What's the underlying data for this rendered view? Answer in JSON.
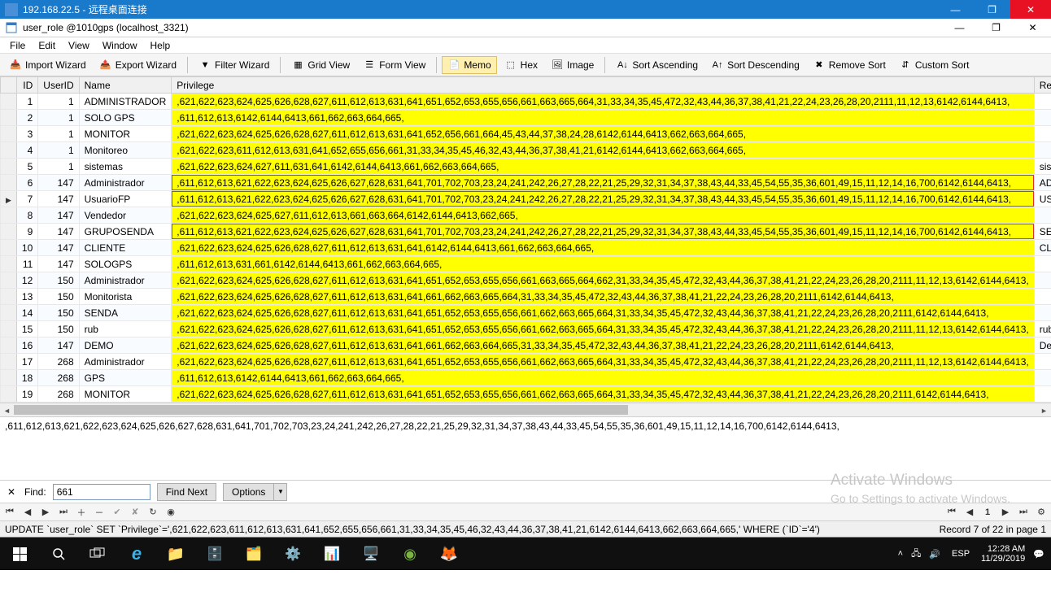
{
  "rdp": {
    "title": "192.168.22.5 - 远程桌面连接"
  },
  "app": {
    "title": "user_role @1010gps (localhost_3321)"
  },
  "menu": {
    "file": "File",
    "edit": "Edit",
    "view": "View",
    "window": "Window",
    "help": "Help"
  },
  "toolbar": {
    "import": "Import Wizard",
    "export": "Export Wizard",
    "filter": "Filter Wizard",
    "grid": "Grid View",
    "form": "Form View",
    "memo": "Memo",
    "hex": "Hex",
    "image": "Image",
    "sort_asc": "Sort Ascending",
    "sort_desc": "Sort Descending",
    "remove_sort": "Remove Sort",
    "custom_sort": "Custom Sort"
  },
  "columns": {
    "id": "ID",
    "userid": "UserID",
    "name": "Name",
    "privilege": "Privilege",
    "ren": "Ren"
  },
  "rows": [
    {
      "id": 1,
      "uid": 1,
      "name": "ADMINISTRADOR",
      "priv": ",621,622,623,624,625,626,628,627,611,612,613,631,641,651,652,653,655,656,661,663,665,664,31,33,34,35,45,472,32,43,44,36,37,38,41,21,22,24,23,26,28,20,2111,11,12,13,6142,6144,6413,",
      "ren": "",
      "hl": "yellow"
    },
    {
      "id": 2,
      "uid": 1,
      "name": "SOLO GPS",
      "priv": ",611,612,613,6142,6144,6413,661,662,663,664,665,",
      "ren": "",
      "hl": "yellow"
    },
    {
      "id": 3,
      "uid": 1,
      "name": "MONITOR",
      "priv": ",621,622,623,624,625,626,628,627,611,612,613,631,641,652,656,661,664,45,43,44,37,38,24,28,6142,6144,6413,662,663,664,665,",
      "ren": "",
      "hl": "yellow"
    },
    {
      "id": 4,
      "uid": 1,
      "name": "Monitoreo",
      "priv": ",621,622,623,611,612,613,631,641,652,655,656,661,31,33,34,35,45,46,32,43,44,36,37,38,41,21,6142,6144,6413,662,663,664,665,",
      "ren": "",
      "hl": "yellow"
    },
    {
      "id": 5,
      "uid": 1,
      "name": "sistemas",
      "priv": ",621,622,623,624,627,611,631,641,6142,6144,6413,661,662,663,664,665,",
      "ren": "siste",
      "hl": "yellow"
    },
    {
      "id": 6,
      "uid": 147,
      "name": "Administrador",
      "priv": ",611,612,613,621,622,623,624,625,626,627,628,631,641,701,702,703,23,24,241,242,26,27,28,22,21,25,29,32,31,34,37,38,43,44,33,45,54,55,35,36,601,49,15,11,12,14,16,700,6142,6144,6413,",
      "ren": "ADM",
      "hl": "red"
    },
    {
      "id": 7,
      "uid": 147,
      "name": "UsuarioFP",
      "priv": ",611,612,613,621,622,623,624,625,626,627,628,631,641,701,702,703,23,24,241,242,26,27,28,22,21,25,29,32,31,34,37,38,43,44,33,45,54,55,35,36,601,49,15,11,12,14,16,700,6142,6144,6413,",
      "ren": "USE",
      "hl": "red",
      "current": true
    },
    {
      "id": 8,
      "uid": 147,
      "name": "Vendedor",
      "priv": ",621,622,623,624,625,627,611,612,613,661,663,664,6142,6144,6413,662,665,",
      "ren": "",
      "hl": "yellow"
    },
    {
      "id": 9,
      "uid": 147,
      "name": "GRUPOSENDA",
      "priv": ",611,612,613,621,622,623,624,625,626,627,628,631,641,701,702,703,23,24,241,242,26,27,28,22,21,25,29,32,31,34,37,38,43,44,33,45,54,55,35,36,601,49,15,11,12,14,16,700,6142,6144,6413,",
      "ren": "SEN",
      "hl": "red"
    },
    {
      "id": 10,
      "uid": 147,
      "name": "CLIENTE",
      "priv": ",621,622,623,624,625,626,628,627,611,612,613,631,641,6142,6144,6413,661,662,663,664,665,",
      "ren": "CLIE",
      "hl": "yellow"
    },
    {
      "id": 11,
      "uid": 147,
      "name": "SOLOGPS",
      "priv": ",611,612,613,631,661,6142,6144,6413,661,662,663,664,665,",
      "ren": "",
      "hl": "yellow"
    },
    {
      "id": 12,
      "uid": 150,
      "name": "Administrador",
      "priv": ",621,622,623,624,625,626,628,627,611,612,613,631,641,651,652,653,655,656,661,663,665,664,662,31,33,34,35,45,472,32,43,44,36,37,38,41,21,22,24,23,26,28,20,2111,11,12,13,6142,6144,6413,",
      "ren": "",
      "hl": "yellow"
    },
    {
      "id": 13,
      "uid": 150,
      "name": "Monitorista",
      "priv": ",621,622,623,624,625,626,628,627,611,612,613,631,641,661,662,663,665,664,31,33,34,35,45,472,32,43,44,36,37,38,41,21,22,24,23,26,28,20,2111,6142,6144,6413,",
      "ren": "",
      "hl": "yellow"
    },
    {
      "id": 14,
      "uid": 150,
      "name": "SENDA",
      "priv": ",621,622,623,624,625,626,628,627,611,612,613,631,641,651,652,653,655,656,661,662,663,665,664,31,33,34,35,45,472,32,43,44,36,37,38,41,21,22,24,23,26,28,20,2111,6142,6144,6413,",
      "ren": "",
      "hl": "yellow"
    },
    {
      "id": 15,
      "uid": 150,
      "name": "rub",
      "priv": ",621,622,623,624,625,626,628,627,611,612,613,631,641,651,652,653,655,656,661,662,663,665,664,31,33,34,35,45,472,32,43,44,36,37,38,41,21,22,24,23,26,28,20,2111,11,12,13,6142,6144,6413,",
      "ren": "rub",
      "hl": "yellow"
    },
    {
      "id": 16,
      "uid": 147,
      "name": "DEMO",
      "priv": ",621,622,623,624,625,626,628,627,611,612,613,631,641,661,662,663,664,665,31,33,34,35,45,472,32,43,44,36,37,38,41,21,22,24,23,26,28,20,2111,6142,6144,6413,",
      "ren": "Den",
      "hl": "yellow"
    },
    {
      "id": 17,
      "uid": 268,
      "name": "Administrador",
      "priv": ",621,622,623,624,625,626,628,627,611,612,613,631,641,651,652,653,655,656,661,662,663,665,664,31,33,34,35,45,472,32,43,44,36,37,38,41,21,22,24,23,26,28,20,2111,11,12,13,6142,6144,6413,",
      "ren": "",
      "hl": "yellow"
    },
    {
      "id": 18,
      "uid": 268,
      "name": "GPS",
      "priv": ",611,612,613,6142,6144,6413,661,662,663,664,665,",
      "ren": "",
      "hl": "yellow"
    },
    {
      "id": 19,
      "uid": 268,
      "name": "MONITOR",
      "priv": ",621,622,623,624,625,626,628,627,611,612,613,631,641,651,652,653,655,656,661,662,663,665,664,31,33,34,35,45,472,32,43,44,36,37,38,41,21,22,24,23,26,28,20,2111,6142,6144,6413,",
      "ren": "",
      "hl": "yellow"
    }
  ],
  "detail": ",611,612,613,621,622,623,624,625,626,627,628,631,641,701,702,703,23,24,241,242,26,27,28,22,21,25,29,32,31,34,37,38,43,44,33,45,54,55,35,36,601,49,15,11,12,14,16,700,6142,6144,6413,",
  "find": {
    "label": "Find:",
    "value": "661",
    "next": "Find Next",
    "options": "Options"
  },
  "watermark": {
    "title": "Activate Windows",
    "sub": "Go to Settings to activate Windows."
  },
  "status": {
    "sql": "UPDATE `user_role` SET `Privilege`=',621,622,623,611,612,613,631,641,652,655,656,661,31,33,34,35,45,46,32,43,44,36,37,38,41,21,6142,6144,6413,662,663,664,665,' WHERE (`ID`='4')",
    "record": "Record 7 of 22 in page 1"
  },
  "tray": {
    "lang": "ESP",
    "time": "12:28 AM",
    "date": "11/29/2019"
  }
}
